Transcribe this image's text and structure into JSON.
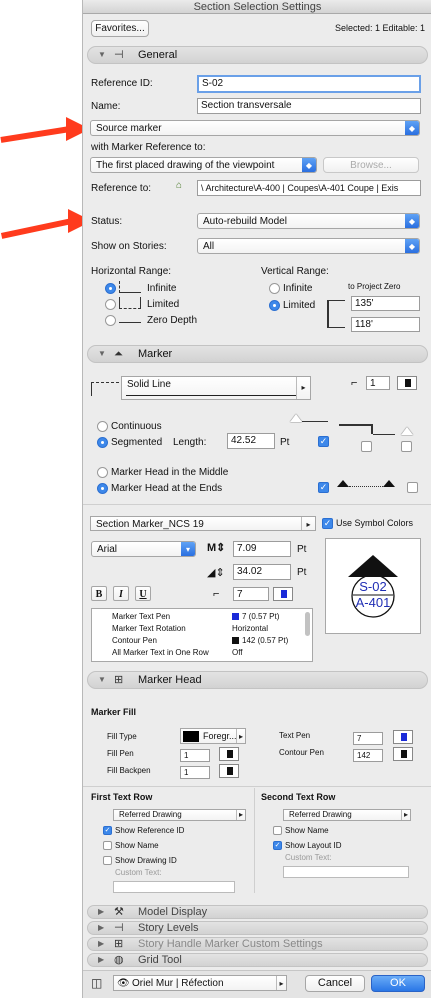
{
  "window": {
    "title": "Section Selection Settings"
  },
  "topbar": {
    "favorites_label": "Favorites...",
    "selected_info": "Selected: 1 Editable: 1"
  },
  "general": {
    "title": "General",
    "reference_id_label": "Reference ID:",
    "reference_id_value": "S-02",
    "name_label": "Name:",
    "name_value": "Section transversale",
    "source_marker": "Source marker",
    "with_marker_label": "with Marker Reference to:",
    "marker_ref_value": "The first placed drawing of the viewpoint",
    "browse_label": "Browse...",
    "reference_to_label": "Reference to:",
    "reference_to_value": "\\ Architecture\\A-400 | Coupes\\A-401 Coupe | Exis",
    "status_label": "Status:",
    "status_value": "Auto-rebuild Model",
    "show_on_stories_label": "Show on Stories:",
    "show_on_stories_value": "All",
    "horizontal_range_label": "Horizontal Range:",
    "h_infinite": "Infinite",
    "h_limited": "Limited",
    "h_zero_depth": "Zero Depth",
    "vertical_range_label": "Vertical Range:",
    "v_infinite": "Infinite",
    "v_limited": "Limited",
    "to_project_zero": "to Project Zero",
    "v_top": "135'",
    "v_bottom": "118'"
  },
  "marker": {
    "title": "Marker",
    "line_type": "Solid Line",
    "line_pen": "1",
    "continuous": "Continuous",
    "segmented": "Segmented",
    "length_label": "Length:",
    "length_value": "42.52",
    "length_unit": "Pt",
    "head_middle": "Marker Head in the Middle",
    "head_ends": "Marker Head at the Ends",
    "symbol": "Section Marker_NCS 19",
    "use_symbol_colors": "Use Symbol Colors",
    "font": "Arial",
    "size_1": "7.09",
    "size_1_unit": "Pt",
    "size_2": "34.02",
    "size_2_unit": "Pt",
    "text_pen": "7",
    "bold": "B",
    "italic": "I",
    "underline": "U",
    "props": [
      {
        "name": "Marker Text Pen",
        "value": "7 (0.57 Pt)"
      },
      {
        "name": "Marker Text Rotation",
        "value": "Horizontal"
      },
      {
        "name": "Contour Pen",
        "value": "142 (0.57 Pt)"
      },
      {
        "name": "All Marker Text in One Row",
        "value": "Off"
      }
    ],
    "preview_top": "S-02",
    "preview_bottom": "A-401"
  },
  "marker_head": {
    "title": "Marker Head",
    "fill_title": "Marker Fill",
    "fill_type_label": "Fill Type",
    "fill_type_value": "Foregr...",
    "fill_pen_label": "Fill Pen",
    "fill_pen_value": "1",
    "fill_backpen_label": "Fill Backpen",
    "fill_backpen_value": "1",
    "text_pen_label": "Text Pen",
    "text_pen_value": "7",
    "contour_pen_label": "Contour Pen",
    "contour_pen_value": "142",
    "first_row_title": "First Text Row",
    "second_row_title": "Second Text Row",
    "first_row_value": "Referred Drawing",
    "second_row_value": "Referred Drawing",
    "show_reference_id": "Show Reference ID",
    "show_name_1": "Show Name",
    "show_drawing_id": "Show Drawing ID",
    "custom_text_1": "Custom Text:",
    "show_name_2": "Show Name",
    "show_layout_id": "Show Layout ID",
    "custom_text_2": "Custom Text:"
  },
  "collapsed": {
    "model_display": "Model Display",
    "story_levels": "Story Levels",
    "story_handle": "Story Handle Marker Custom Settings",
    "grid_tool": "Grid Tool"
  },
  "footer": {
    "layer_value": "Oriel  Mur | Réfection",
    "cancel_label": "Cancel",
    "ok_label": "OK"
  },
  "colors": {
    "accent": "#3d88ea",
    "annotation_arrow": "#ff3b1d",
    "title_bar": "#d9d9d9"
  }
}
